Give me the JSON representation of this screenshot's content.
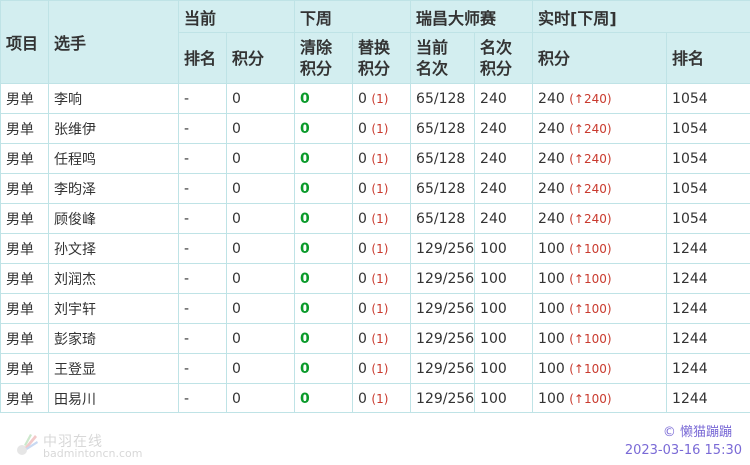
{
  "header": {
    "col_event": "项目",
    "col_player": "选手",
    "group_current": "当前",
    "group_next_week": "下周",
    "group_tournament": "瑞昌大师赛",
    "group_live": "实时[下周]",
    "current_rank": "排名",
    "current_points": "积分",
    "clear_points_line1": "清除",
    "clear_points_line2": "积分",
    "replace_points_line1": "替换",
    "replace_points_line2": "积分",
    "cur_place_line1": "当前",
    "cur_place_line2": "名次",
    "place_points_line1": "名次",
    "place_points_line2": "积分",
    "live_points": "积分",
    "live_rank": "排名"
  },
  "rows": [
    {
      "event": "男单",
      "player": "李响",
      "cur_rank": "-",
      "cur_points": "0",
      "clear": "0",
      "replace": "0",
      "replace_count": "(1)",
      "place": "65/128",
      "place_points": "240",
      "live_points": "240",
      "live_delta": "(↑240)",
      "live_rank": "1054"
    },
    {
      "event": "男单",
      "player": "张维伊",
      "cur_rank": "-",
      "cur_points": "0",
      "clear": "0",
      "replace": "0",
      "replace_count": "(1)",
      "place": "65/128",
      "place_points": "240",
      "live_points": "240",
      "live_delta": "(↑240)",
      "live_rank": "1054"
    },
    {
      "event": "男单",
      "player": "任程鸣",
      "cur_rank": "-",
      "cur_points": "0",
      "clear": "0",
      "replace": "0",
      "replace_count": "(1)",
      "place": "65/128",
      "place_points": "240",
      "live_points": "240",
      "live_delta": "(↑240)",
      "live_rank": "1054"
    },
    {
      "event": "男单",
      "player": "李昀泽",
      "cur_rank": "-",
      "cur_points": "0",
      "clear": "0",
      "replace": "0",
      "replace_count": "(1)",
      "place": "65/128",
      "place_points": "240",
      "live_points": "240",
      "live_delta": "(↑240)",
      "live_rank": "1054"
    },
    {
      "event": "男单",
      "player": "顾俊峰",
      "cur_rank": "-",
      "cur_points": "0",
      "clear": "0",
      "replace": "0",
      "replace_count": "(1)",
      "place": "65/128",
      "place_points": "240",
      "live_points": "240",
      "live_delta": "(↑240)",
      "live_rank": "1054"
    },
    {
      "event": "男单",
      "player": "孙文择",
      "cur_rank": "-",
      "cur_points": "0",
      "clear": "0",
      "replace": "0",
      "replace_count": "(1)",
      "place": "129/256",
      "place_points": "100",
      "live_points": "100",
      "live_delta": "(↑100)",
      "live_rank": "1244"
    },
    {
      "event": "男单",
      "player": "刘润杰",
      "cur_rank": "-",
      "cur_points": "0",
      "clear": "0",
      "replace": "0",
      "replace_count": "(1)",
      "place": "129/256",
      "place_points": "100",
      "live_points": "100",
      "live_delta": "(↑100)",
      "live_rank": "1244"
    },
    {
      "event": "男单",
      "player": "刘宇轩",
      "cur_rank": "-",
      "cur_points": "0",
      "clear": "0",
      "replace": "0",
      "replace_count": "(1)",
      "place": "129/256",
      "place_points": "100",
      "live_points": "100",
      "live_delta": "(↑100)",
      "live_rank": "1244"
    },
    {
      "event": "男单",
      "player": "彭家琦",
      "cur_rank": "-",
      "cur_points": "0",
      "clear": "0",
      "replace": "0",
      "replace_count": "(1)",
      "place": "129/256",
      "place_points": "100",
      "live_points": "100",
      "live_delta": "(↑100)",
      "live_rank": "1244"
    },
    {
      "event": "男单",
      "player": "王登显",
      "cur_rank": "-",
      "cur_points": "0",
      "clear": "0",
      "replace": "0",
      "replace_count": "(1)",
      "place": "129/256",
      "place_points": "100",
      "live_points": "100",
      "live_delta": "(↑100)",
      "live_rank": "1244"
    },
    {
      "event": "男单",
      "player": "田易川",
      "cur_rank": "-",
      "cur_points": "0",
      "clear": "0",
      "replace": "0",
      "replace_count": "(1)",
      "place": "129/256",
      "place_points": "100",
      "live_points": "100",
      "live_delta": "(↑100)",
      "live_rank": "1244"
    }
  ],
  "footer": {
    "logo_cn": "中羽在线",
    "logo_en": "badmintoncn.com",
    "credit": "© 懒猫蹦蹦",
    "timestamp": "2023-03-16 15:30"
  },
  "colors": {
    "header_bg": "#d3eef0",
    "border": "#bfe3e6",
    "green": "#0a9a2a",
    "red": "#c93a2e",
    "credit": "#7a6ad6"
  },
  "icons": {
    "logo": "shuttlecock-icon"
  }
}
